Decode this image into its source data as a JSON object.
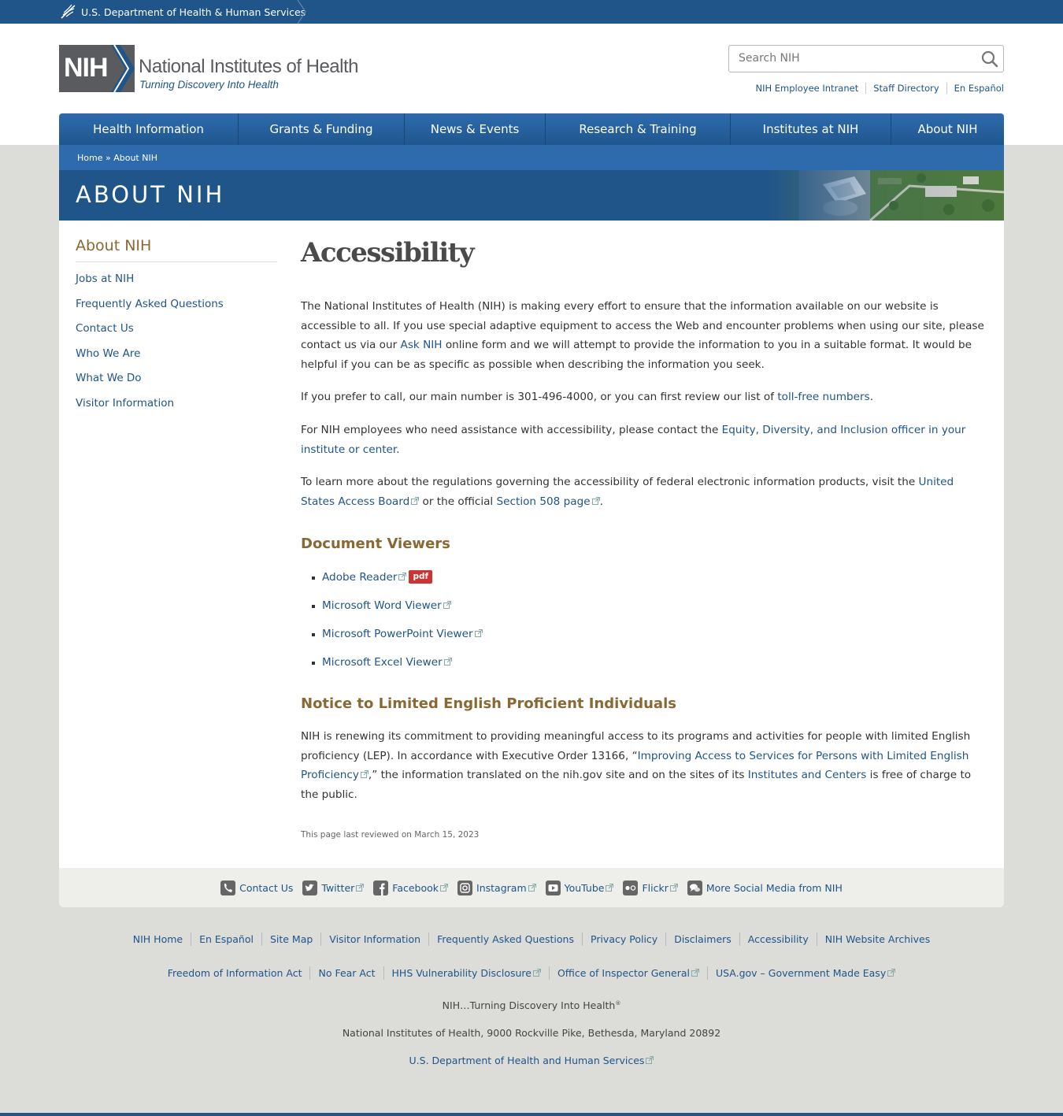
{
  "hhs": {
    "label": "U.S. Department of Health & Human Services"
  },
  "logo": {
    "abbr": "NIH",
    "title": "National Institutes of Health",
    "tagline": "Turning Discovery Into Health"
  },
  "search": {
    "placeholder": "Search NIH"
  },
  "utility_links": [
    "NIH Employee Intranet",
    "Staff Directory",
    "En Español"
  ],
  "nav": [
    "Health Information",
    "Grants & Funding",
    "News & Events",
    "Research & Training",
    "Institutes at NIH",
    "About NIH"
  ],
  "breadcrumb": {
    "home": "Home",
    "sep": " » ",
    "current": "About NIH"
  },
  "banner": {
    "title": "ABOUT NIH"
  },
  "sidebar": {
    "title": "About NIH",
    "items": [
      "Jobs at NIH",
      "Frequently Asked Questions",
      "Contact Us",
      "Who We Are",
      "What We Do",
      "Visitor Information"
    ]
  },
  "content": {
    "title": "Accessibility",
    "p1": {
      "a": "The National Institutes of Health (NIH) is making every effort to ensure that the information available on our website is accessible to all. If you use special adaptive equipment to access the Web and encounter problems when using our site, please contact us via our ",
      "link": "Ask NIH",
      "b": " online form and we will attempt to provide the information to you in a suitable format. It would be helpful if you can be as specific as possible when describing the information you seek."
    },
    "p2": {
      "a": "If you prefer to call, our main number is 301-496-4000, or you can first review our list of ",
      "link": "toll-free numbers",
      "b": "."
    },
    "p3": {
      "a": "For NIH employees who need assistance with accessibility, please contact the ",
      "link": "Equity, Diversity, and Inclusion officer in your institute or center",
      "b": "."
    },
    "p4": {
      "a": "To learn more about the regulations governing the accessibility of federal electronic information products, visit the ",
      "link1": "United States Access Board",
      "mid": " or the official ",
      "link2": "Section 508 page",
      "b": "."
    },
    "viewers_heading": "Document Viewers",
    "viewers": [
      "Adobe Reader",
      "Microsoft Word Viewer",
      "Microsoft PowerPoint Viewer",
      "Microsoft Excel Viewer"
    ],
    "pdf_badge": "pdf",
    "lep_heading": "Notice to Limited English Proficient Individuals",
    "p5": {
      "a": "NIH is renewing its commitment to providing meaningful access to its programs and activities for people with limited English proficiency (LEP). In accordance with Executive Order 13166, “",
      "link1": "Improving Access to Services for Persons with Limited English Proficiency",
      "mid": ",” the information translated on the nih.gov site and on the sites of its ",
      "link2": "Institutes and Centers",
      "b": " is free of charge to the public."
    },
    "reviewed": "This page last reviewed on March 15, 2023"
  },
  "social": [
    "Contact Us",
    "Twitter",
    "Facebook",
    "Instagram",
    "YouTube",
    "Flickr",
    "More Social Media from NIH"
  ],
  "footer": {
    "row1": [
      "NIH Home",
      "En Español",
      "Site Map",
      "Visitor Information",
      "Frequently Asked Questions",
      "Privacy Policy",
      "Disclaimers",
      "Accessibility",
      "NIH Website Archives"
    ],
    "row2": [
      "Freedom of Information Act",
      "No Fear Act",
      "HHS Vulnerability Disclosure",
      "Office of Inspector General",
      "USA.gov – Government Made Easy"
    ],
    "tagline": "NIH…Turning Discovery Into Health",
    "reg": "®",
    "address": "National Institutes of Health, 9000 Rockville Pike, Bethesda, Maryland 20892",
    "hhs_link": "U.S. Department of Health and Human Services"
  },
  "colors": {
    "brand_blue": "#20558a",
    "nav_blue": "#2e6bad",
    "heading_gold": "#8a6834",
    "pdf_red": "#cc3333"
  },
  "icons": [
    "hhs-eagle-icon",
    "search-icon",
    "external-link-icon",
    "phone-icon",
    "twitter-icon",
    "facebook-icon",
    "instagram-icon",
    "youtube-icon",
    "flickr-icon",
    "chat-bubbles-icon"
  ]
}
